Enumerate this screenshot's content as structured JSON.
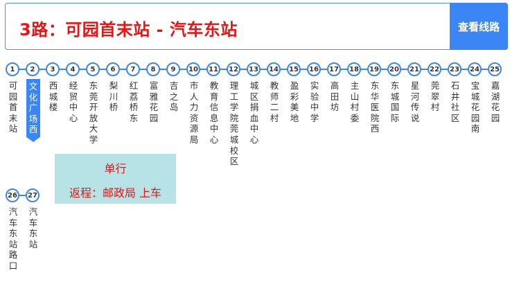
{
  "header": {
    "route_title": "3路：可园首末站 - 汽车东站",
    "view_button": "查看线路"
  },
  "note": {
    "line1": "单行",
    "line2": "返程：邮政局 上车"
  },
  "stops_row1": [
    {
      "num": "1",
      "name": "可园首末站"
    },
    {
      "num": "2",
      "name": "文化广场西"
    },
    {
      "num": "3",
      "name": "西城楼"
    },
    {
      "num": "4",
      "name": "经贸中心"
    },
    {
      "num": "5",
      "name": "东莞开放大学"
    },
    {
      "num": "6",
      "name": "梨川桥"
    },
    {
      "num": "7",
      "name": "红荔桥东"
    },
    {
      "num": "8",
      "name": "富雅花园"
    },
    {
      "num": "9",
      "name": "吉之岛"
    },
    {
      "num": "10",
      "name": "市人力资源局"
    },
    {
      "num": "11",
      "name": "教育信息中心"
    },
    {
      "num": "12",
      "name": "理工学院莞城校区"
    },
    {
      "num": "13",
      "name": "城区捐血中心"
    },
    {
      "num": "14",
      "name": "教师二村"
    },
    {
      "num": "15",
      "name": "盈彩美地"
    },
    {
      "num": "16",
      "name": "实验中学"
    },
    {
      "num": "17",
      "name": "高田坊"
    },
    {
      "num": "18",
      "name": "主山村委"
    },
    {
      "num": "19",
      "name": "东华医院西"
    },
    {
      "num": "20",
      "name": "东城国际"
    },
    {
      "num": "21",
      "name": "星河传说"
    },
    {
      "num": "22",
      "name": "莞翠村"
    },
    {
      "num": "23",
      "name": "石井社区"
    },
    {
      "num": "24",
      "name": "宝城花园南"
    },
    {
      "num": "25",
      "name": "嘉湖花园"
    }
  ],
  "stops_row2": [
    {
      "num": "26",
      "name": "汽车东站路口"
    },
    {
      "num": "27",
      "name": "汽车东站"
    }
  ],
  "current_stop_index": 1,
  "colors": {
    "accent": "#3b86f4",
    "title": "#ee1111",
    "note_bg": "#b7e2e6"
  }
}
